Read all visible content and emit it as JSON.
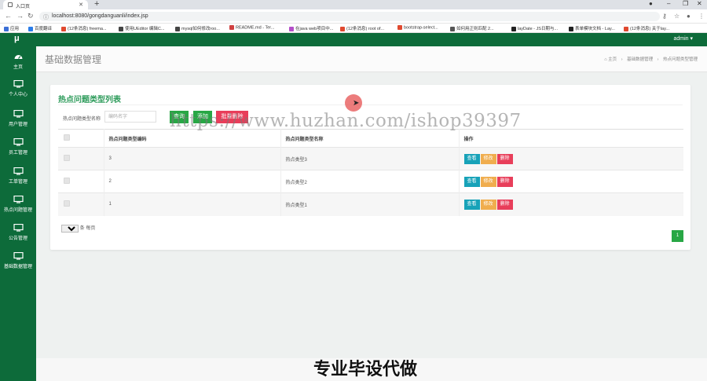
{
  "browser": {
    "tab_title": "入口页",
    "url": "localhost:8080/gongdanguanli/index.jsp",
    "bookmarks": [
      {
        "label": "应用",
        "color": "#3b6fd6"
      },
      {
        "label": "百度翻译",
        "color": "#2b7de9"
      },
      {
        "label": "(12条消息) freema...",
        "color": "#e0492f"
      },
      {
        "label": "使用UEditor 编辑C...",
        "color": "#444444"
      },
      {
        "label": "mysql如何修改roo...",
        "color": "#444444"
      },
      {
        "label": "README.md - Ter...",
        "color": "#d04040"
      },
      {
        "label": "在java web项目中...",
        "color": "#b44ec9"
      },
      {
        "label": "(12条消息) root of...",
        "color": "#e0492f"
      },
      {
        "label": "bootstrap-select...",
        "color": "#e0492f"
      },
      {
        "label": "如何用正则匹配 2...",
        "color": "#555555"
      },
      {
        "label": "layDate - JS日期与...",
        "color": "#222222"
      },
      {
        "label": "表单模块文档 - Lay...",
        "color": "#222222"
      },
      {
        "label": "(12条消息) 关于lay...",
        "color": "#e0492f"
      }
    ]
  },
  "topbar": {
    "brand": "μ",
    "user": "admin ▾"
  },
  "sidebar": {
    "items": [
      {
        "label": "主页",
        "icon": "dashboard-icon"
      },
      {
        "label": "个人中心",
        "icon": "monitor-icon"
      },
      {
        "label": "用户管理",
        "icon": "monitor-icon"
      },
      {
        "label": "员工管理",
        "icon": "monitor-icon"
      },
      {
        "label": "工单管理",
        "icon": "monitor-icon"
      },
      {
        "label": "热点问题管理",
        "icon": "monitor-icon"
      },
      {
        "label": "公告管理",
        "icon": "monitor-icon"
      },
      {
        "label": "基础数据管理",
        "icon": "monitor-icon"
      }
    ]
  },
  "page": {
    "title": "基础数据管理",
    "breadcrumb": {
      "home": "主页",
      "level1": "基础数据管理",
      "level2": "热点问题类型管理"
    }
  },
  "panel": {
    "title": "热点问题类型列表",
    "search": {
      "label": "热点问题类型名称",
      "placeholder": "编码名字",
      "value": ""
    },
    "buttons": {
      "query": "查询",
      "add": "添加",
      "batch_delete": "批量删除"
    },
    "table": {
      "columns": [
        "",
        "热点问题类型编码",
        "热点问题类型名称",
        "操作"
      ],
      "rows": [
        {
          "code": "3",
          "name": "热点类型3"
        },
        {
          "code": "2",
          "name": "热点类型2"
        },
        {
          "code": "1",
          "name": "热点类型1"
        }
      ],
      "actions": {
        "view": "查看",
        "edit": "修改",
        "delete": "删除"
      }
    },
    "pagination": {
      "page_size": "10",
      "page_size_suffix": "条 每页",
      "current_page": "1"
    }
  },
  "overlay": {
    "watermark": "https://www.huzhan.com/ishop39397",
    "banner": "专业毕设代做"
  },
  "colors": {
    "theme_green": "#0d6b3a",
    "title_green": "#2f9c5c",
    "button_green": "#28a745",
    "button_red": "#e83e5a",
    "button_teal": "#17a2b8",
    "button_orange": "#f0ad4e"
  }
}
